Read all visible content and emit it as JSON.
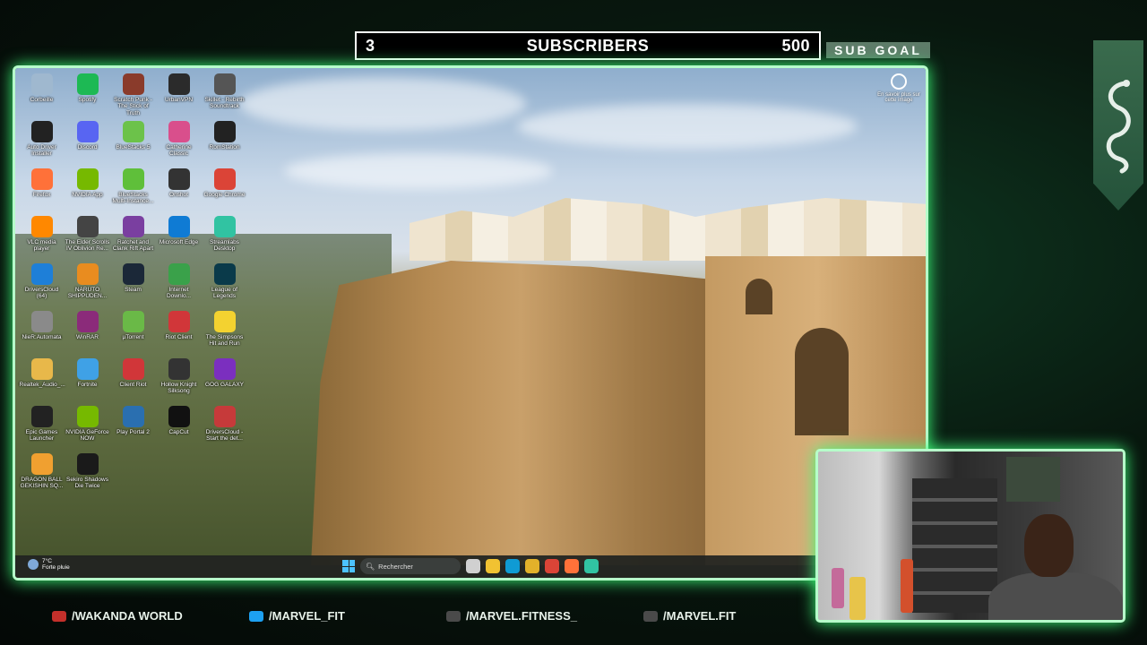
{
  "sub_goal": {
    "current": "3",
    "title": "SUBSCRIBERS",
    "target": "500",
    "label": "SUB GOAL",
    "progress_fraction": 0.006
  },
  "desktop": {
    "icons": [
      {
        "label": "Corbeille",
        "icon": "recycle-bin-icon",
        "color": "#9fb8cf"
      },
      {
        "label": "Spotify",
        "icon": "spotify-icon",
        "color": "#1db954"
      },
      {
        "label": "Scratch Punk - The Stick of Truth",
        "icon": "game-icon",
        "color": "#8a3b2b"
      },
      {
        "label": "UrbanVPN",
        "icon": "vpn-icon",
        "color": "#2b2b2b"
      },
      {
        "label": "Skillet - Rebirth Soundtrack",
        "icon": "music-icon",
        "color": "#555555"
      },
      {
        "label": "Auto Driver Installer",
        "icon": "adi-icon",
        "color": "#222222"
      },
      {
        "label": "Discord",
        "icon": "discord-icon",
        "color": "#5865f2"
      },
      {
        "label": "BlueStacks 5",
        "icon": "bluestacks-icon",
        "color": "#6cc24a"
      },
      {
        "label": "Catherine Classic",
        "icon": "catherine-icon",
        "color": "#d94f8c"
      },
      {
        "label": "RomStation",
        "icon": "romstation-icon",
        "color": "#222222"
      },
      {
        "label": "Firefox",
        "icon": "firefox-icon",
        "color": "#ff7139"
      },
      {
        "label": "NVIDIA App",
        "icon": "nvidia-icon",
        "color": "#76b900"
      },
      {
        "label": "BlueStacks Multi-Instance...",
        "icon": "bluestacks-multi-icon",
        "color": "#5fbf3a"
      },
      {
        "label": "Onshot",
        "icon": "onshot-icon",
        "color": "#333333"
      },
      {
        "label": "Google Chrome",
        "icon": "chrome-icon",
        "color": "#db4437"
      },
      {
        "label": "VLC media player",
        "icon": "vlc-icon",
        "color": "#ff8800"
      },
      {
        "label": "The Elder Scrolls IV Oblivion Re...",
        "icon": "oblivion-icon",
        "color": "#444444"
      },
      {
        "label": "Ratchet and Clank Rift Apart",
        "icon": "ratchet-icon",
        "color": "#7a3fa0"
      },
      {
        "label": "Microsoft Edge",
        "icon": "edge-icon",
        "color": "#0f7bd4"
      },
      {
        "label": "Streamlabs Desktop",
        "icon": "streamlabs-icon",
        "color": "#31c3a2"
      },
      {
        "label": "DriversCloud (64)",
        "icon": "driverscloud-icon",
        "color": "#1e7fd8"
      },
      {
        "label": "NARUTO SHIPPUDEN...",
        "icon": "naruto-icon",
        "color": "#e98c1f"
      },
      {
        "label": "Steam",
        "icon": "steam-icon",
        "color": "#1b2838"
      },
      {
        "label": "Internet Downlo...",
        "icon": "idm-icon",
        "color": "#3aa14a"
      },
      {
        "label": "League of Legends",
        "icon": "lol-icon",
        "color": "#0a3a4a"
      },
      {
        "label": "NieR:Automata",
        "icon": "nier-icon",
        "color": "#8a8a8a"
      },
      {
        "label": "WinRAR",
        "icon": "winrar-icon",
        "color": "#8b2b7a"
      },
      {
        "label": "µTorrent",
        "icon": "utorrent-icon",
        "color": "#6ab947"
      },
      {
        "label": "Riot Client",
        "icon": "riot-icon",
        "color": "#d13639"
      },
      {
        "label": "The Simpsons Hit and Run",
        "icon": "simpsons-icon",
        "color": "#f3d230"
      },
      {
        "label": "Realtek_Audio_...",
        "icon": "folder-icon",
        "color": "#e8b84a"
      },
      {
        "label": "Fortnite",
        "icon": "fortnite-icon",
        "color": "#3fa1e6"
      },
      {
        "label": "Client Riot",
        "icon": "riot-client-icon",
        "color": "#d13639"
      },
      {
        "label": "Hollow Knight Silksong",
        "icon": "silksong-icon",
        "color": "#333333"
      },
      {
        "label": "GOG GALAXY",
        "icon": "gog-icon",
        "color": "#7b2fbf"
      },
      {
        "label": "Epic Games Launcher",
        "icon": "epic-icon",
        "color": "#222222"
      },
      {
        "label": "NVIDIA GeForce NOW",
        "icon": "geforce-now-icon",
        "color": "#76b900"
      },
      {
        "label": "Play Portal 2",
        "icon": "portal-icon",
        "color": "#2a6fb0"
      },
      {
        "label": "CapCut",
        "icon": "capcut-icon",
        "color": "#111111"
      },
      {
        "label": "DriversCloud - Start the det...",
        "icon": "driverscloud-start-icon",
        "color": "#c63a3a"
      },
      {
        "label": "DRAGON BALL GEKISHIN SQ...",
        "icon": "dragonball-icon",
        "color": "#f0a030"
      },
      {
        "label": "Sekiro Shadows Die Twice",
        "icon": "sekiro-icon",
        "color": "#1a1a1a"
      }
    ],
    "corner_widget_text": "En savoir plus sur cette image",
    "taskbar": {
      "weather_temp": "7°C",
      "weather_desc": "Forte pluie",
      "search_placeholder": "Rechercher",
      "apps": [
        {
          "icon": "task-view-icon",
          "color": "#d0d0d0"
        },
        {
          "icon": "file-explorer-icon",
          "color": "#f1c232"
        },
        {
          "icon": "edge-icon",
          "color": "#0f9bd4"
        },
        {
          "icon": "store-icon",
          "color": "#e2b12a"
        },
        {
          "icon": "chrome-icon",
          "color": "#db4437"
        },
        {
          "icon": "firefox-icon",
          "color": "#ff7139"
        },
        {
          "icon": "streamlabs-icon",
          "color": "#31c3a2"
        }
      ]
    }
  },
  "socials": [
    {
      "icon": "youtube-icon",
      "color": "#c4302b",
      "handle": "/WAKANDA WORLD"
    },
    {
      "icon": "twitter-icon",
      "color": "#1da1f2",
      "handle": "/MARVEL_FIT"
    },
    {
      "icon": "instagram-icon",
      "color": "#4a4a4a",
      "handle": "/MARVEL.FITNESS_"
    },
    {
      "icon": "tiktok-icon",
      "color": "#4a4a4a",
      "handle": "/MARVEL.FIT"
    }
  ],
  "colors": {
    "frame_glow": "#3dff7a",
    "frame_border": "#b6ffca",
    "goal_label_bg": "#5e7c69",
    "banner": "#3a6b4d"
  }
}
